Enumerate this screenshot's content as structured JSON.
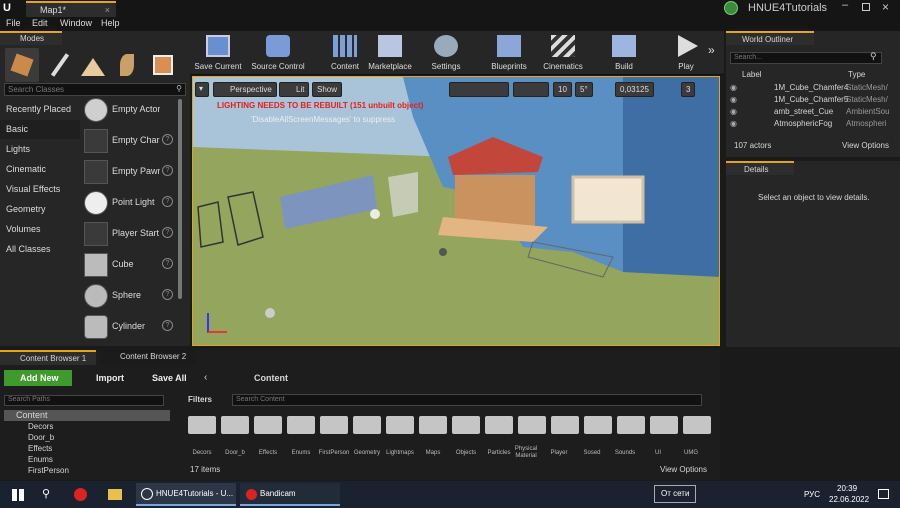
{
  "window": {
    "app_logo": "U",
    "tab_title": "Map1*",
    "project_name": "HNUE4Tutorials"
  },
  "menu": [
    "File",
    "Edit",
    "Window",
    "Help"
  ],
  "modes": {
    "tab_label": "Modes",
    "search_placeholder": "Search Classes",
    "categories": [
      "Recently Placed",
      "Basic",
      "Lights",
      "Cinematic",
      "Visual Effects",
      "Geometry",
      "Volumes",
      "All Classes"
    ],
    "active_category": "Basic",
    "items": [
      "Empty Actor",
      "Empty Chara",
      "Empty Pawn",
      "Point Light",
      "Player Start",
      "Cube",
      "Sphere",
      "Cylinder"
    ]
  },
  "toolbar": {
    "buttons": [
      "Save Current",
      "Source Control",
      "Content",
      "Marketplace",
      "Settings",
      "Blueprints",
      "Cinematics",
      "Build",
      "Play"
    ]
  },
  "viewport": {
    "perspective": "Perspective",
    "lit": "Lit",
    "show": "Show",
    "warning": "LIGHTING NEEDS TO BE REBUILT (151 unbuilt object)",
    "hint": "'DisableAllScreenMessages' to suppress",
    "grid_snap": "10",
    "rot_snap": "5°",
    "scale_snap": "0,03125",
    "cam_speed": "3"
  },
  "outliner": {
    "title": "World Outliner",
    "search_placeholder": "Search...",
    "col_label": "Label",
    "col_type": "Type",
    "rows": [
      {
        "label": "1M_Cube_Chamfer4",
        "type": "StaticMesh/"
      },
      {
        "label": "1M_Cube_Chamfer5",
        "type": "StaticMesh/"
      },
      {
        "label": "amb_street_Cue",
        "type": "AmbientSou"
      },
      {
        "label": "AtmosphericFog",
        "type": "Atmospheri"
      }
    ],
    "count": "107 actors",
    "view_options": "View Options"
  },
  "details": {
    "title": "Details",
    "empty_text": "Select an object to view details."
  },
  "content_browser": {
    "tab1": "Content Browser 1",
    "tab2": "Content Browser 2",
    "add_new": "Add New",
    "import": "Import",
    "save_all": "Save All",
    "path": "Content",
    "search_paths": "Search Paths",
    "filters": "Filters",
    "search_content": "Search Content",
    "tree": [
      "Content",
      "Decors",
      "Door_b",
      "Effects",
      "Enums",
      "FirstPerson"
    ],
    "folders": [
      "Decors",
      "Door_b",
      "Effects",
      "Enums",
      "FirstPerson",
      "Geometry",
      "Lightmaps",
      "Maps",
      "Objects",
      "Particles",
      "Physical Material",
      "Player",
      "Sosed",
      "Sounds",
      "UI",
      "UMG"
    ],
    "items_count": "17 items",
    "view_options": "View Options"
  },
  "taskbar": {
    "app1": "HNUE4Tutorials - U...",
    "app2": "Bandicam",
    "network": "От сети",
    "lang": "РУС",
    "time": "20:39",
    "date": "22.06.2022"
  },
  "colors": {
    "accent": "#e8a417",
    "warning": "#ff3030",
    "add_new": "#3e9a2d"
  }
}
